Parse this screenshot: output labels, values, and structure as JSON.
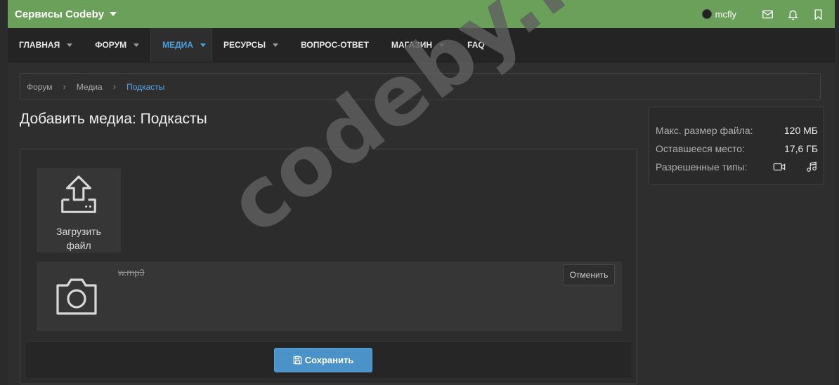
{
  "topbar": {
    "brand": "Сервисы Codeby",
    "username": "mcfly",
    "icons": [
      "envelope-icon",
      "bell-icon",
      "bookmark-icon"
    ]
  },
  "nav": {
    "items": [
      {
        "label": "ГЛАВНАЯ",
        "has_dropdown": true,
        "active": false
      },
      {
        "label": "ФОРУМ",
        "has_dropdown": true,
        "active": false
      },
      {
        "label": "МЕДИА",
        "has_dropdown": true,
        "active": true
      },
      {
        "label": "РЕСУРСЫ",
        "has_dropdown": true,
        "active": false
      },
      {
        "label": "ВОПРОС-ОТВЕТ",
        "has_dropdown": false,
        "active": false
      },
      {
        "label": "МАГАЗИН",
        "has_dropdown": true,
        "active": false
      },
      {
        "label": "FAQ",
        "has_dropdown": false,
        "active": false
      }
    ]
  },
  "breadcrumb": [
    "Форум",
    "Медиа",
    "Подкасты"
  ],
  "page": {
    "title": "Добавить медиа: Подкасты"
  },
  "sidebar": {
    "max_size_label": "Макс. размер файла:",
    "max_size_value": "120 МБ",
    "remaining_label": "Оставшееся место:",
    "remaining_value": "17,6 ГБ",
    "types_label": "Разрешенные типы:",
    "type_icons": [
      "video-icon",
      "music-icon"
    ]
  },
  "upload": {
    "label": "Загрузить файл"
  },
  "media_item": {
    "filename": "w.mp3",
    "cancel_label": "Отменить"
  },
  "footer": {
    "save_label": "Сохранить"
  },
  "watermark": "codeby.net",
  "colors": {
    "topbar": "#6aa05a",
    "accent": "#4aa0e0",
    "save_button": "#4a92c8"
  }
}
